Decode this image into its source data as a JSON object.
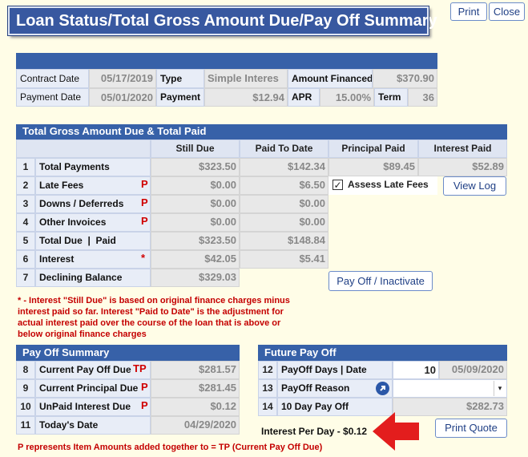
{
  "window": {
    "title": "Loan Status/Total Gross Amount Due/Pay Off Summary",
    "print_label": "Print",
    "close_label": "Close"
  },
  "loan_info": {
    "contract_date_label": "Contract Date",
    "contract_date": "05/17/2019",
    "type_label": "Type",
    "type_value": "Simple Interes",
    "amount_financed_label": "Amount Financed",
    "amount_financed": "$370.90",
    "payment_date_label": "Payment Date",
    "payment_date": "05/01/2020",
    "payment_label": "Payment",
    "payment_value": "$12.94",
    "apr_label": "APR",
    "apr_value": "15.00%",
    "term_label": "Term",
    "term_value": "36"
  },
  "totals": {
    "section_title": "Total Gross Amount Due & Total Paid",
    "col_still_due": "Still Due",
    "col_paid_to_date": "Paid To Date",
    "col_principal_paid": "Principal Paid",
    "col_interest_paid": "Interest Paid",
    "rows": [
      {
        "num": "1",
        "label": "Total Payments",
        "flag": "",
        "still_due": "$323.50",
        "paid": "$142.34"
      },
      {
        "num": "2",
        "label": "Late Fees",
        "flag": "P",
        "still_due": "$0.00",
        "paid": "$6.50"
      },
      {
        "num": "3",
        "label": "Downs / Deferreds",
        "flag": "P",
        "still_due": "$0.00",
        "paid": "$0.00"
      },
      {
        "num": "4",
        "label": "Other Invoices",
        "flag": "P",
        "still_due": "$0.00",
        "paid": "$0.00"
      },
      {
        "num": "5",
        "label": "Total Due  |  Paid",
        "flag": "",
        "still_due": "$323.50",
        "paid": "$148.84"
      },
      {
        "num": "6",
        "label": "Interest",
        "flag": "*",
        "still_due": "$42.05",
        "paid": "$5.41"
      },
      {
        "num": "7",
        "label": "Declining Balance",
        "flag": "",
        "still_due": "$329.03",
        "paid": ""
      }
    ],
    "principal_paid": "$89.45",
    "interest_paid": "$52.89",
    "assess_late_fees_label": "Assess Late Fees",
    "assess_late_fees_checked": true,
    "check_mark": "✓",
    "view_log_label": "View Log",
    "payoff_inactivate_label": "Pay Off / Inactivate",
    "interest_note": "* - Interest \"Still Due\" is based on original finance charges minus interest paid so far. Interest \"Paid to Date\" is the adjustment for actual interest paid over the course of the loan that is above or below original finance charges"
  },
  "payoff_summary": {
    "section_title": "Pay Off Summary",
    "rows": [
      {
        "num": "8",
        "label": "Current Pay Off Due",
        "flag": "TP",
        "value": "$281.57"
      },
      {
        "num": "9",
        "label": "Current Principal Due",
        "flag": "P",
        "value": "$281.45"
      },
      {
        "num": "10",
        "label": "UnPaid Interest Due",
        "flag": "P",
        "value": "$0.12"
      },
      {
        "num": "11",
        "label": "Today's Date",
        "flag": "",
        "value": "04/29/2020"
      }
    ],
    "footnote": "P represents Item Amounts added together to = TP (Current Pay Off Due)"
  },
  "future_payoff": {
    "section_title": "Future Pay Off",
    "row12_num": "12",
    "row12_label": "PayOff Days | Date",
    "payoff_days": "10",
    "payoff_date": "05/09/2020",
    "row13_num": "13",
    "row13_label": "PayOff Reason",
    "payoff_reason_value": "",
    "row14_num": "14",
    "row14_label": "10 Day Pay Off",
    "ten_day_payoff": "$282.73",
    "interest_per_day": "Interest Per Day - $0.12",
    "print_quote_label": "Print Quote"
  },
  "icons": {
    "dropdown": "chevron-down-icon",
    "payoff_reason_link": "arrow-link-icon",
    "annotation": "red-arrow-icon"
  },
  "colors": {
    "header_blue": "#3761a8",
    "background": "#fffde7",
    "flag_red": "#d00000",
    "annotation_red": "#e31d1d"
  }
}
